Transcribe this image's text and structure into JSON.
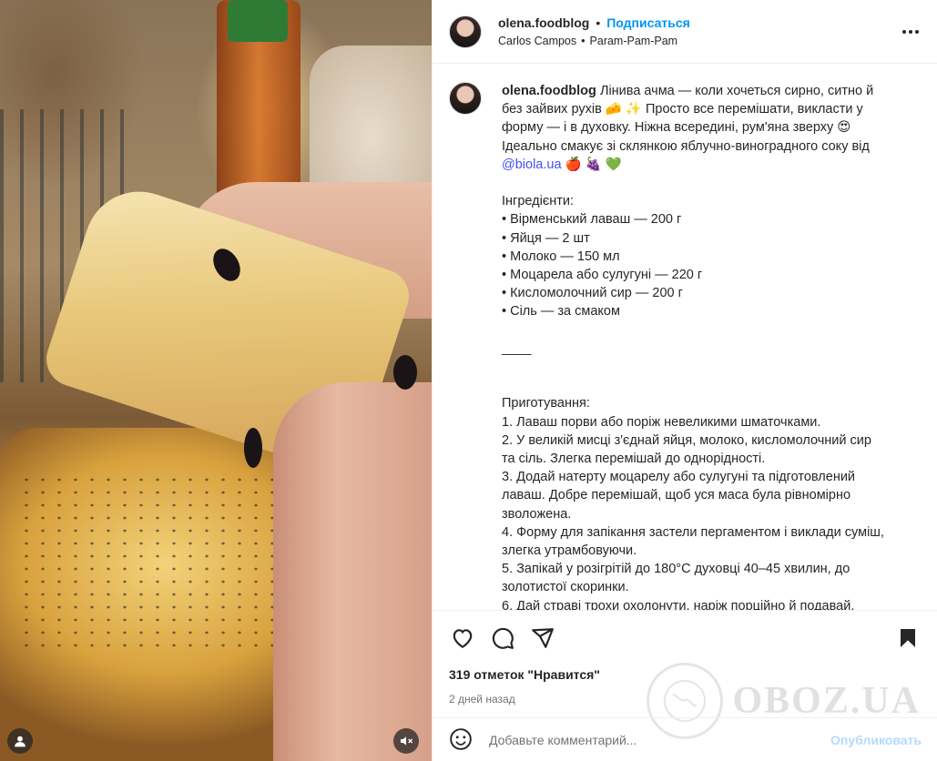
{
  "header": {
    "username": "olena.foodblog",
    "separator": "•",
    "follow_label": "Подписаться",
    "audio_artist": "Carlos Campos",
    "audio_separator": "•",
    "audio_title": "Param-Pam-Pam"
  },
  "caption": {
    "username": "olena.foodblog",
    "lines": [
      "Лінива ачма — коли хочеться сирно, ситно й",
      "без зайвих рухів 🧀 ✨ Просто все перемішати, викласти у",
      "форму — і в духовку. Ніжна всередині, рум'яна зверху 😍",
      "Ідеально смакує зі склянкою яблучно-виноградного соку від"
    ],
    "mention": "@biola.ua",
    "mention_emojis": "🍎 🍇 💚",
    "ingredients_title": "Інгредієнти:",
    "ingredients": [
      "• Вірменський лаваш — 200 г",
      "• Яйця — 2 шт",
      "• Молоко — 150 мл",
      "• Моцарела або сулугуні — 220 г",
      "• Кисломолочний сир — 200 г",
      "• Сіль — за смаком"
    ],
    "divider": "____",
    "steps_title": "Приготування:",
    "steps": [
      "1. Лаваш порви або поріж невеликими шматочками.",
      "2. У великій мисці з'єднай яйця, молоко, кисломолочний сир",
      "та сіль. Злегка перемішай до однорідності.",
      "3. Додай натерту моцарелу або сулугуні та підготовлений",
      "лаваш. Добре перемішай, щоб уся маса була рівномірно",
      "зволожена.",
      "4. Форму для запікання застели пергаментом і виклади суміш,",
      "злегка утрамбовуючи.",
      "5. Запікай у розігрітій до 180°C духовці 40–45 хвилин, до",
      "золотистої скоринки.",
      "6. Дай страві трохи охолонути, наріж порційно й подавай."
    ]
  },
  "actions": {
    "likes": "319 отметок \"Нравится\"",
    "date": "2 дней назад"
  },
  "comment": {
    "placeholder": "Добавьте комментарий...",
    "post_label": "Опубликовать"
  },
  "watermark": {
    "text": "OBOZ.UA"
  },
  "icons": {
    "like": "heart-icon",
    "comment": "comment-icon",
    "share": "share-icon",
    "save": "bookmark-icon",
    "more": "more-icon",
    "emoji": "emoji-icon",
    "mute": "mute-icon",
    "tagged": "user-icon"
  },
  "colors": {
    "follow": "#0095f6",
    "mention": "#4150f7",
    "post_disabled": "#b3dbff",
    "meta_gray": "#737373"
  }
}
